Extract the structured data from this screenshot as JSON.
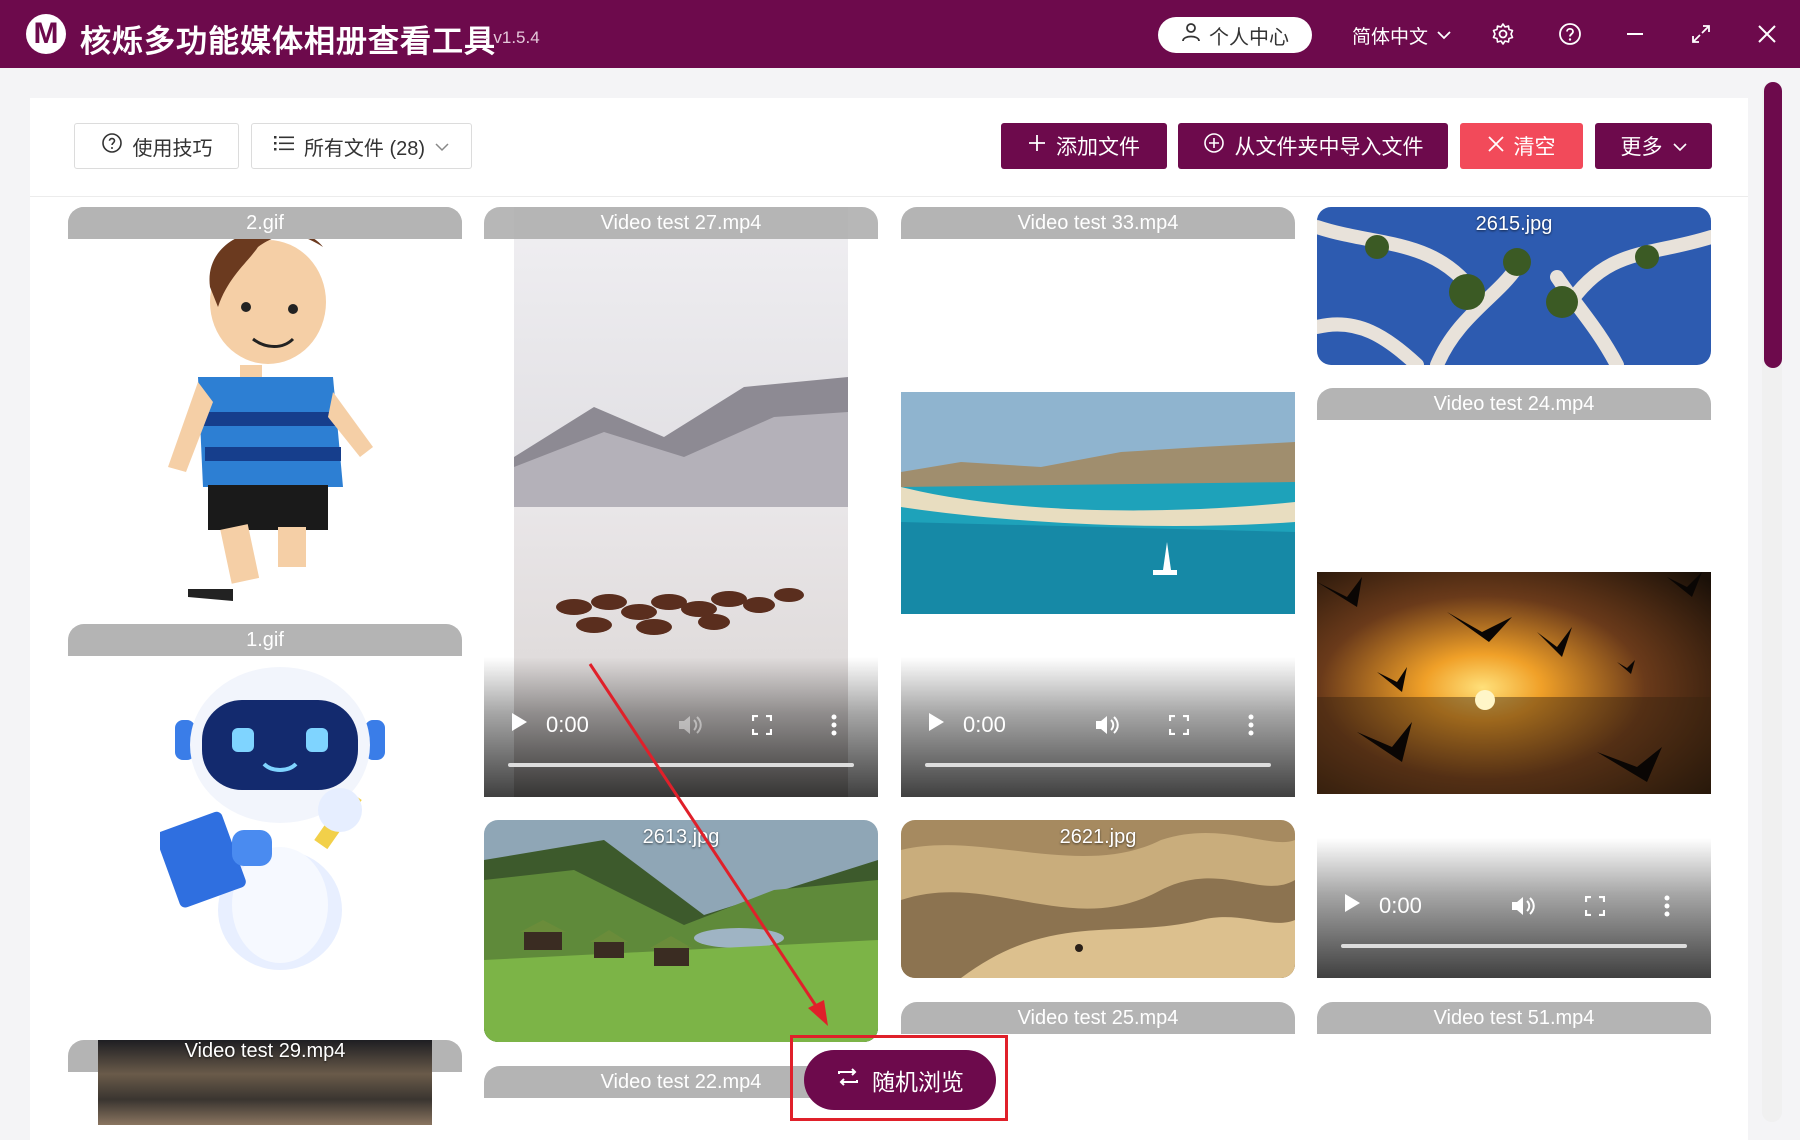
{
  "app": {
    "logo_letter": "M",
    "title": "核烁多功能媒体相册查看工具",
    "version": "- v1.5.4"
  },
  "titlebar": {
    "user_center": "个人中心",
    "language": "简体中文",
    "icons": [
      "user-icon",
      "chevron-down-icon",
      "gear-icon",
      "help-icon",
      "minimize-icon",
      "maximize-icon",
      "close-icon"
    ]
  },
  "toolbar": {
    "tips": "使用技巧",
    "filter": "所有文件 (28)",
    "add_file": "添加文件",
    "import_folder": "从文件夹中导入文件",
    "clear": "清空",
    "more": "更多"
  },
  "media": [
    {
      "name": "2.gif",
      "kind": "gif-cartoon-boy"
    },
    {
      "name": "1.gif",
      "kind": "gif-robot"
    },
    {
      "name": "Video test 29.mp4",
      "kind": "video-waves"
    },
    {
      "name": "Video test 27.mp4",
      "kind": "video-horses",
      "time": "0:00"
    },
    {
      "name": "2613.jpg",
      "kind": "image-valley"
    },
    {
      "name": "Video test 22.mp4",
      "kind": "video"
    },
    {
      "name": "Video test 33.mp4",
      "kind": "video-bay",
      "time": "0:00"
    },
    {
      "name": "2621.jpg",
      "kind": "image-desert"
    },
    {
      "name": "Video test 25.mp4",
      "kind": "video"
    },
    {
      "name": "2615.jpg",
      "kind": "image-trees"
    },
    {
      "name": "Video test 24.mp4",
      "kind": "video-sunset-birds",
      "time": "0:00"
    },
    {
      "name": "Video test 51.mp4",
      "kind": "video"
    }
  ],
  "random_browse": "随机浏览",
  "colors": {
    "brand": "#6d0a4c",
    "danger": "#f24a5a",
    "tab_grey": "#b4b4b4"
  }
}
